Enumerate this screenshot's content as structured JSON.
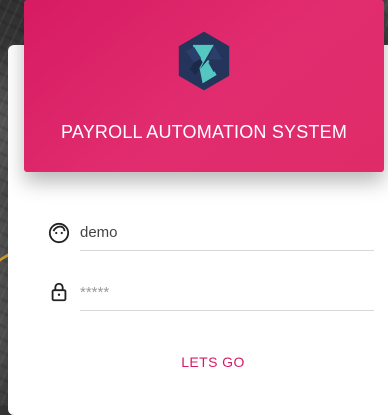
{
  "app": {
    "title": "PAYROLL AUTOMATION SYSTEM"
  },
  "login": {
    "username_value": "demo",
    "password_placeholder": "*****",
    "submit_label": "LETS GO"
  },
  "icons": {
    "logo": "app-logo-icon",
    "user": "user-icon",
    "lock": "lock-icon"
  },
  "colors": {
    "brand_primary": "#d71b63",
    "accent": "#f1b22b",
    "logo_teal": "#55c7c2",
    "logo_navy": "#24345a",
    "card_background": "#ffffff"
  }
}
